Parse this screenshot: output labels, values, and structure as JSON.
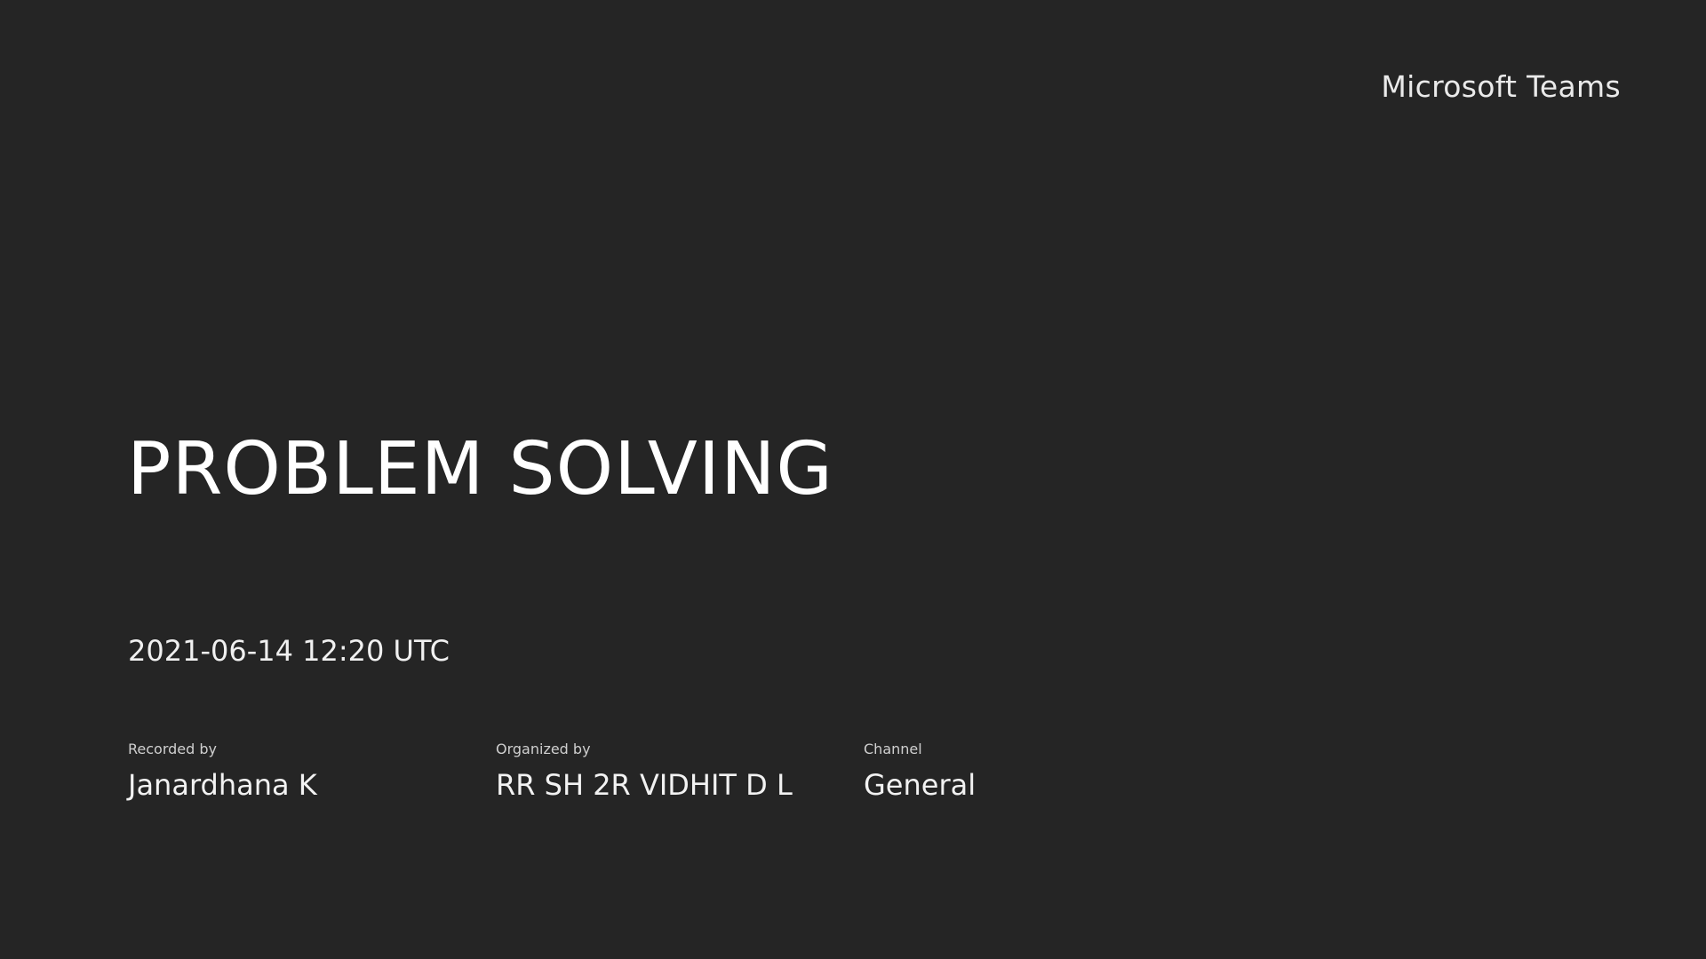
{
  "header": {
    "brand": "Microsoft Teams"
  },
  "meeting": {
    "title": "PROBLEM SOLVING",
    "datetime": "2021-06-14 12:20 UTC"
  },
  "details": {
    "recorded_by": {
      "label": "Recorded by",
      "value": "Janardhana K"
    },
    "organized_by": {
      "label": "Organized by",
      "value": "RR SH 2R VIDHIT D L"
    },
    "channel": {
      "label": "Channel",
      "value": "General"
    }
  },
  "colors": {
    "background": "#252525",
    "text": "#ffffff"
  }
}
